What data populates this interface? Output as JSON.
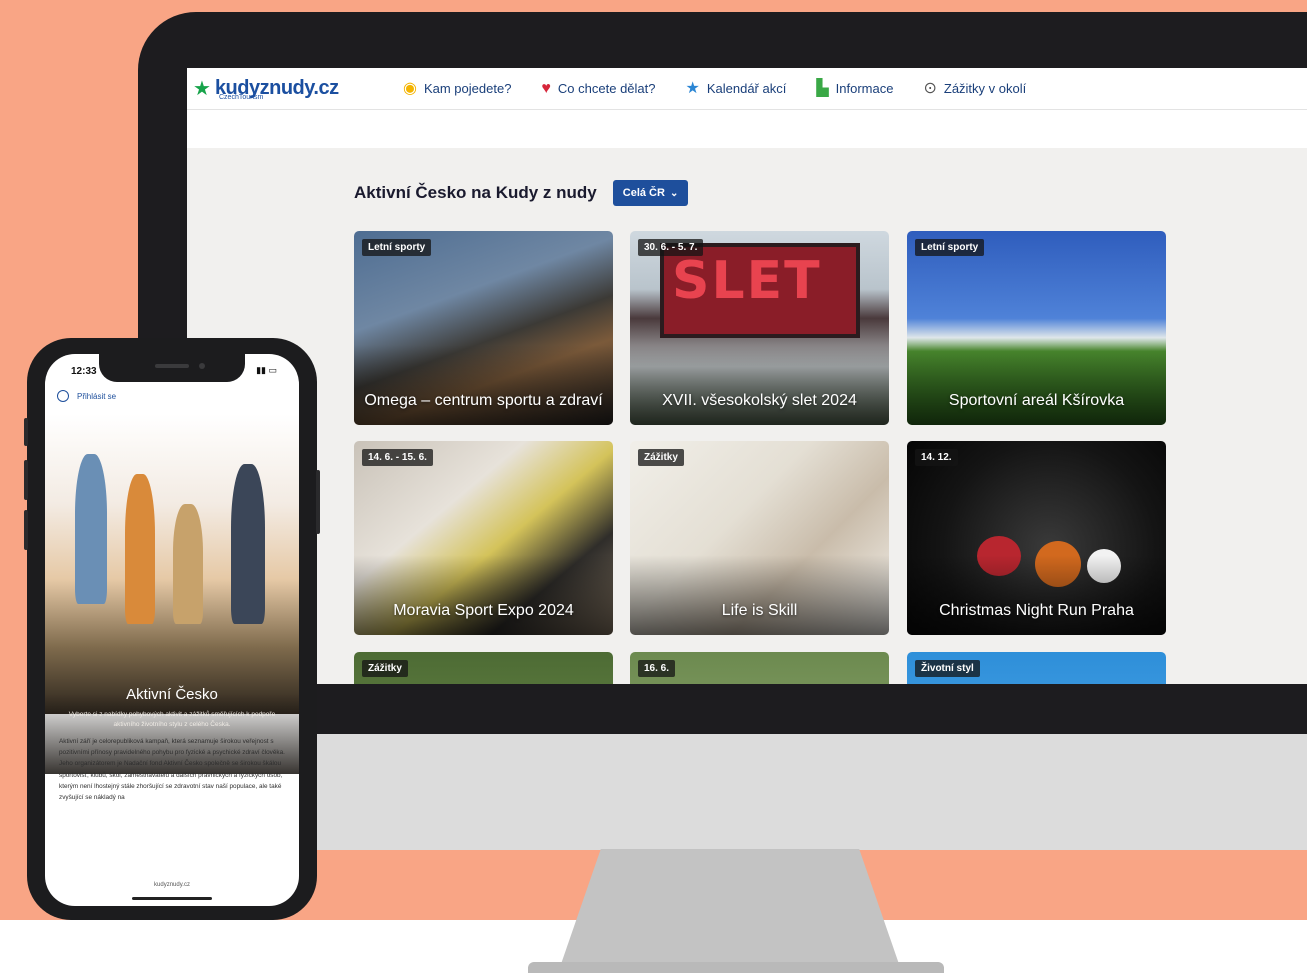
{
  "nav": {
    "logo": "kudyznudy.cz",
    "logo_sub": "CzechTourism",
    "items": [
      {
        "label": "Kam pojedete?",
        "icon": "location-pin-icon"
      },
      {
        "label": "Co chcete dělat?",
        "icon": "heart-icon"
      },
      {
        "label": "Kalendář akcí",
        "icon": "star-icon"
      },
      {
        "label": "Informace",
        "icon": "info-chart-icon"
      },
      {
        "label": "Zážitky v okolí",
        "icon": "compass-icon"
      }
    ]
  },
  "page": {
    "heading": "Aktivní Česko na Kudy z nudy",
    "region_button": "Celá ČR"
  },
  "cards": [
    {
      "badge": "Letní sporty",
      "title": "Omega – centrum sportu a zdraví"
    },
    {
      "badge": "30. 6. - 5. 7.",
      "title": "XVII. všesokolský slet 2024"
    },
    {
      "badge": "Letní sporty",
      "title": "Sportovní areál Kšírovka"
    },
    {
      "badge": "14. 6. - 15. 6.",
      "title": "Moravia Sport Expo 2024"
    },
    {
      "badge": "Zážitky",
      "title": "Life is Skill"
    },
    {
      "badge": "14. 12.",
      "title": "Christmas Night Run Praha"
    },
    {
      "badge": "Zážitky",
      "title": ""
    },
    {
      "badge": "16. 6.",
      "title": ""
    },
    {
      "badge": "Životní styl",
      "title": ""
    }
  ],
  "slet_sign": "SLET",
  "phone": {
    "time": "12:33",
    "login": "Přihlásit se",
    "hero_title": "Aktivní Česko",
    "hero_desc": "Vyberte si z nabídky pohybových aktivit a zážitků směřujících k podpoře aktivního životního stylu z celého Česka.",
    "article": "Aktivní září je celorepubliková kampaň, která seznamuje širokou veřejnost s pozitivními přínosy pravidelného pohybu pro fyzické a psychické zdraví člověka. Jeho organizátorem je Nadační fond Aktivní Česko společně se širokou škálou sportovišť, klubů, škol, zaměstnavatelů a dalších právnických a fyzických osob, kterým není lhostejný stále zhoršující se zdravotní stav naší populace, ale také zvyšující se nákladý na",
    "url": "kudyznudy.cz"
  }
}
